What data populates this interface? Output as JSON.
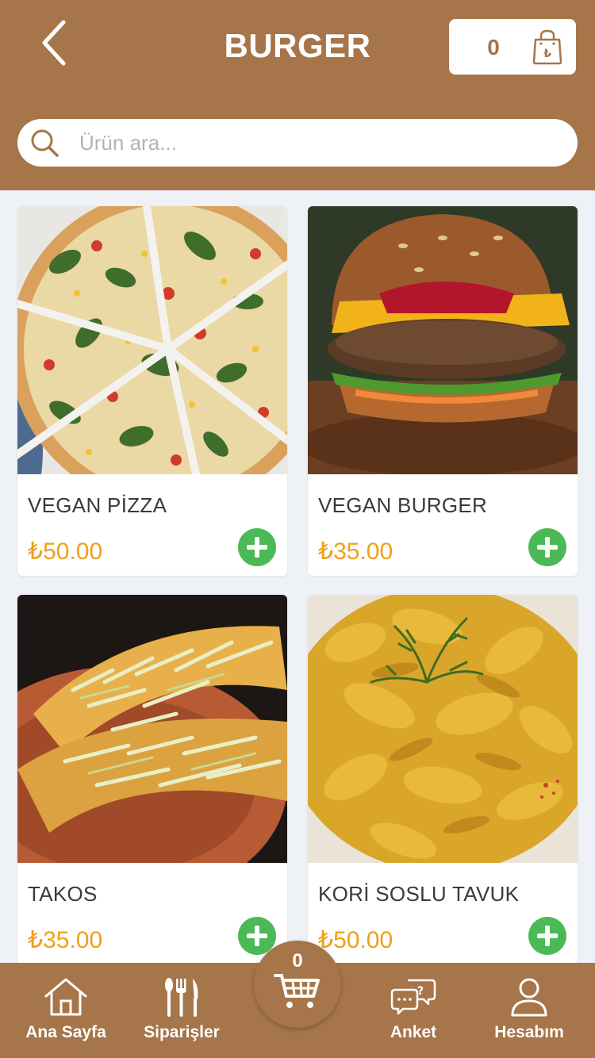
{
  "header": {
    "title": "BURGER",
    "cart_count": "0"
  },
  "search": {
    "placeholder": "Ürün ara..."
  },
  "products": [
    {
      "name": "VEGAN PİZZA",
      "price": "₺50.00",
      "image": "pizza"
    },
    {
      "name": "VEGAN BURGER",
      "price": "₺35.00",
      "image": "burger"
    },
    {
      "name": "TAKOS",
      "price": "₺35.00",
      "image": "tacos"
    },
    {
      "name": "KORİ SOSLU TAVUK",
      "price": "₺50.00",
      "image": "curry-chicken"
    }
  ],
  "bottom_nav": {
    "items": [
      {
        "label": "Ana Sayfa",
        "icon": "home-icon"
      },
      {
        "label": "Siparişler",
        "icon": "cutlery-icon"
      },
      {
        "label": "Anket",
        "icon": "chat-question-icon"
      },
      {
        "label": "Hesabım",
        "icon": "user-icon"
      }
    ],
    "cart_count": "0"
  },
  "colors": {
    "brand": "#a7754a",
    "price": "#f0a019",
    "add": "#4cb957",
    "background": "#eef1f6"
  }
}
